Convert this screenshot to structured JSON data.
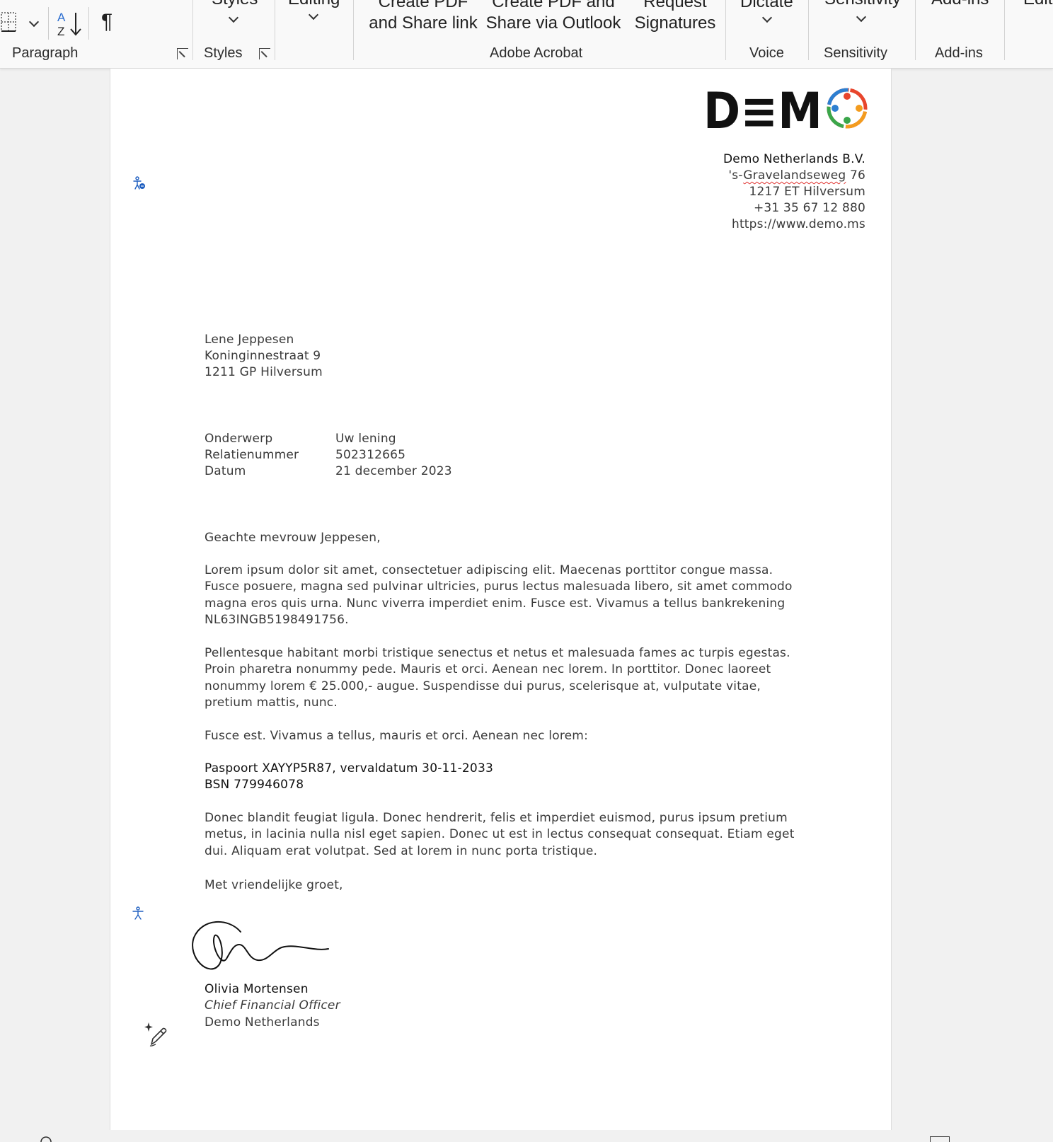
{
  "ribbon": {
    "groups": {
      "paragraph": "Paragraph",
      "styles": "Styles",
      "adobe": "Adobe Acrobat",
      "voice": "Voice",
      "sensitivity": "Sensitivity",
      "addins": "Add-ins"
    },
    "buttons": {
      "styles": "Styles",
      "editing": "Editing",
      "create_pdf_share_line1": "Create PDF",
      "create_pdf_share_line2": "and Share link",
      "create_pdf_outlook_line1": "Create PDF and",
      "create_pdf_outlook_line2": "Share via Outlook",
      "request_sig_line1": "Request",
      "request_sig_line2": "Signatures",
      "dictate": "Dictate",
      "sensitivity": "Sensitivity",
      "addins": "Add-ins",
      "editor": "Edit"
    },
    "icons": {
      "sort": "sort-az-icon",
      "pilcrow": "¶"
    }
  },
  "letter": {
    "logo_text": "D≡M",
    "sender": {
      "company": "Demo Netherlands B.V.",
      "street_prefix": "'s-",
      "street_name": "Gravelandseweg",
      "street_number": " 76",
      "postal_city": "1217 ET Hilversum",
      "phone": "+31 35 67 12 880",
      "website": "https://www.demo.ms"
    },
    "recipient": {
      "name": "Lene Jeppesen",
      "street": "Koninginnestraat 9",
      "postal_city": "1211 GP Hilversum"
    },
    "meta": [
      {
        "label": "Onderwerp",
        "value": "Uw lening"
      },
      {
        "label": "Relatienummer",
        "value": "502312665"
      },
      {
        "label": "Datum",
        "value": "21 december 2023"
      }
    ],
    "salutation": "Geachte mevrouw Jeppesen,",
    "paragraphs": [
      "Lorem ipsum dolor sit amet, consectetuer adipiscing elit. Maecenas porttitor congue massa. Fusce posuere, magna sed pulvinar ultricies, purus lectus malesuada libero, sit amet commodo magna eros quis urna. Nunc viverra imperdiet enim. Fusce est. Vivamus a tellus bankrekening NL63INGB5198491756.",
      "Pellentesque habitant morbi tristique senectus et netus et malesuada fames ac turpis egestas. Proin pharetra nonummy pede. Mauris et orci. Aenean nec lorem. In porttitor. Donec laoreet nonummy lorem € 25.000,- augue. Suspendisse dui purus, scelerisque at, vulputate vitae, pretium mattis, nunc.",
      "Fusce est. Vivamus a tellus, mauris et orci. Aenean nec lorem:"
    ],
    "id_lines": [
      "Paspoort XAYYP5R87, vervaldatum 30-11-2033",
      "BSN 779946078"
    ],
    "closing_paragraph": "Donec blandit feugiat ligula. Donec hendrerit, felis et imperdiet euismod, purus ipsum pretium metus, in lacinia nulla nisl eget sapien. Donec ut est in lectus consequat consequat. Etiam eget dui. Aliquam erat volutpat. Sed at lorem in nunc porta tristique.",
    "closing": "Met vriendelijke groet,",
    "signatory": {
      "name": "Olivia Mortensen",
      "title": "Chief Financial Officer",
      "company": "Demo Netherlands"
    }
  },
  "colors": {
    "accent_blue": "#1f5fc0",
    "logo_dark": "#111111",
    "logo_red": "#e8452c",
    "logo_orange": "#f39c1e",
    "logo_green": "#3aa64a",
    "logo_blue": "#2d7fd1",
    "spell_red": "#e0312e"
  },
  "margin_icons": [
    "accessibility-person-icon",
    "accessibility-person-icon",
    "ai-pen-sparkle-icon"
  ]
}
